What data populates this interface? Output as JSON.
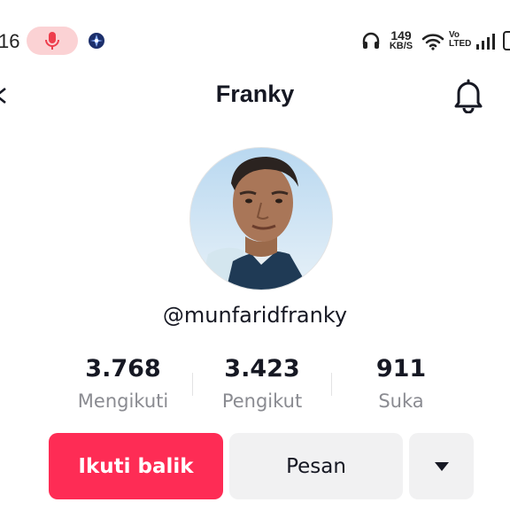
{
  "status_bar": {
    "time": "16",
    "net_speed_value": "149",
    "net_speed_unit": "KB/S",
    "volte_top": "Vo",
    "volte_bottom": "LTED"
  },
  "header": {
    "title": "Franky"
  },
  "profile": {
    "username": "@munfaridfranky"
  },
  "stats": [
    {
      "value": "3.768",
      "label": "Mengikuti"
    },
    {
      "value": "3.423",
      "label": "Pengikut"
    },
    {
      "value": "911",
      "label": "Suka"
    }
  ],
  "actions": {
    "follow_back": "Ikuti balik",
    "message": "Pesan"
  },
  "icons": {
    "mic": "microphone-icon",
    "back": "back-arrow-icon",
    "bell": "bell-icon",
    "dropdown": "triangle-down-icon"
  },
  "colors": {
    "accent": "#fe2c55",
    "mic_pill": "#fbd2d4",
    "button_secondary": "#f1f1f2",
    "muted_text": "#8a8b91"
  }
}
